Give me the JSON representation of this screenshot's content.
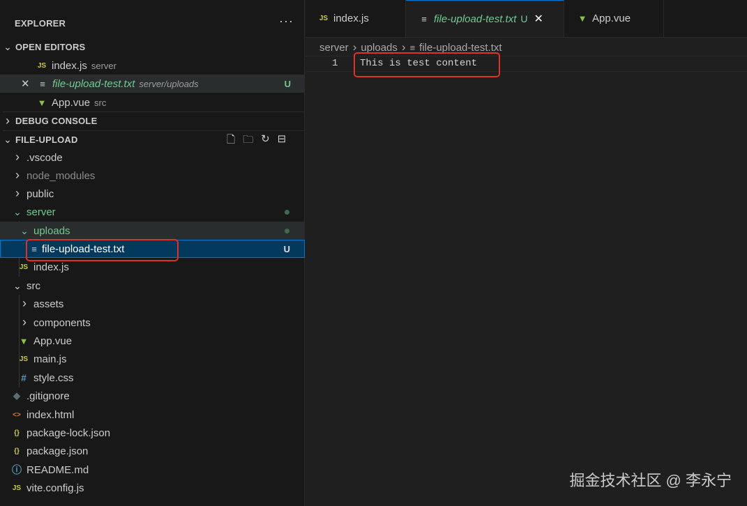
{
  "sidebar": {
    "title": "EXPLORER",
    "more_icon": "ellipsis-icon",
    "open_editors": {
      "title": "OPEN EDITORS",
      "items": [
        {
          "name": "index.js",
          "desc": "server",
          "icon": "js-icon"
        },
        {
          "name": "file-upload-test.txt",
          "desc": "server/uploads",
          "badge": "U",
          "icon": "text-file-icon"
        },
        {
          "name": "App.vue",
          "desc": "src",
          "icon": "vue-icon"
        }
      ]
    },
    "debug_console": {
      "title": "DEBUG CONSOLE"
    },
    "project": {
      "title": "FILE-UPLOAD",
      "tree": {
        "vscode": ".vscode",
        "node_modules": "node_modules",
        "public": "public",
        "server": "server",
        "uploads": "uploads",
        "upload_file": "file-upload-test.txt",
        "upload_badge": "U",
        "server_index": "index.js",
        "src": "src",
        "assets": "assets",
        "components": "components",
        "app_vue": "App.vue",
        "main_js": "main.js",
        "style_css": "style.css",
        "gitignore": ".gitignore",
        "index_html": "index.html",
        "package_lock": "package-lock.json",
        "package_json": "package.json",
        "readme": "README.md",
        "vite_config": "vite.config.js"
      }
    }
  },
  "tabs": [
    {
      "label": "index.js",
      "icon": "js-icon"
    },
    {
      "label": "file-upload-test.txt",
      "badge": "U",
      "icon": "text-file-icon",
      "active": true
    },
    {
      "label": "App.vue",
      "icon": "vue-icon"
    }
  ],
  "breadcrumb": [
    "server",
    "uploads",
    "file-upload-test.txt"
  ],
  "editor": {
    "line_number": "1",
    "line_text": "This is test content"
  },
  "watermark": "掘金技术社区 @ 李永宁",
  "colors": {
    "accent": "#0078d4",
    "untracked": "#73c991",
    "highlight_box": "#e0302a"
  }
}
